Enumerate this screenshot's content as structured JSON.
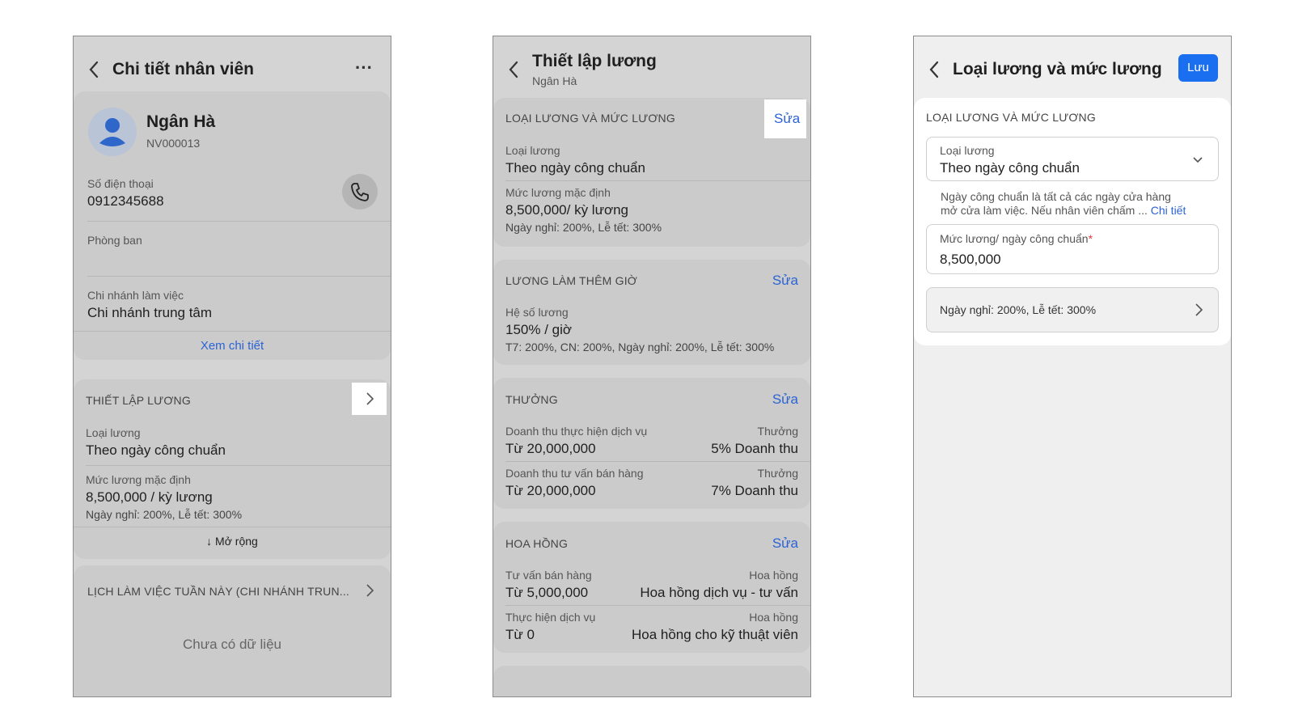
{
  "screen1": {
    "title": "Chi tiết nhân viên",
    "more": "···",
    "employee": {
      "name": "Ngân Hà",
      "code": "NV000013"
    },
    "phone_label": "Số điện thoại",
    "phone_value": "0912345688",
    "department_label": "Phòng ban",
    "branch_label": "Chi nhánh làm việc",
    "branch_value": "Chi nhánh trung tâm",
    "view_detail": "Xem chi tiết",
    "salary_section": "THIẾT LẬP LƯƠNG",
    "salary_type_label": "Loại lương",
    "salary_type_value": "Theo ngày công chuẩn",
    "default_salary_label": "Mức lương mặc định",
    "default_salary_value": "8,500,000 / kỳ lương",
    "holiday_note": "Ngày nghỉ: 200%, Lễ tết: 300%",
    "expand": "↓ Mở rộng",
    "schedule_section": "LỊCH LÀM VIỆC TUẦN NÀY (CHI NHÁNH TRUN...",
    "no_data": "Chưa có dữ liệu"
  },
  "screen2": {
    "title": "Thiết lập lương",
    "subtitle": "Ngân Hà",
    "edit": "Sửa",
    "s1_title": "LOẠI LƯƠNG VÀ MỨC LƯƠNG",
    "s1_type_label": "Loại lương",
    "s1_type_value": "Theo ngày công chuẩn",
    "s1_default_label": "Mức lương mặc định",
    "s1_default_value": "8,500,000/ kỳ lương",
    "s1_note": "Ngày nghỉ: 200%, Lễ tết: 300%",
    "s2_title": "LƯƠNG LÀM THÊM GIỜ",
    "s2_coef_label": "Hệ số lương",
    "s2_coef_value": "150% / giờ",
    "s2_note": "T7: 200%, CN: 200%, Ngày nghỉ: 200%, Lễ tết: 300%",
    "s3_title": "THƯỞNG",
    "s3_r1_label": "Doanh thu thực hiện dịch vụ",
    "s3_r1_value": "Từ 20,000,000",
    "s3_r1_bonus_label": "Thưởng",
    "s3_r1_bonus_value": "5% Doanh thu",
    "s3_r2_label": "Doanh thu tư vấn bán hàng",
    "s3_r2_value": "Từ 20,000,000",
    "s3_r2_bonus_label": "Thưởng",
    "s3_r2_bonus_value": "7% Doanh thu",
    "s4_title": "HOA HỒNG",
    "s4_r1_label": "Tư vấn bán hàng",
    "s4_r1_value": "Từ 5,000,000",
    "s4_r1_comm_label": "Hoa hồng",
    "s4_r1_comm_value": "Hoa hồng dịch vụ - tư vấn",
    "s4_r2_label": "Thực hiện dịch vụ",
    "s4_r2_value": "Từ 0",
    "s4_r2_comm_label": "Hoa hồng",
    "s4_r2_comm_value": "Hoa hồng cho kỹ thuật viên"
  },
  "screen3": {
    "title": "Loại lương và mức lương",
    "save": "Lưu",
    "section": "LOẠI LƯƠNG VÀ MỨC LƯƠNG",
    "type_label": "Loại lương",
    "type_value": "Theo ngày công chuẩn",
    "help_line1": "Ngày công chuẩn là tất cả các ngày cửa hàng",
    "help_line2": "mở cửa làm việc. Nếu nhân viên chấm ...",
    "help_link": "Chi tiết",
    "salary_label": "Mức lương/ ngày công chuẩn",
    "required": "*",
    "salary_value": "8,500,000",
    "holiday_row": "Ngày nghỉ: 200%, Lễ tết: 300%"
  },
  "colors": {
    "accent": "#2b63d6",
    "save_button": "#1a6ef0",
    "required": "#e53935"
  }
}
